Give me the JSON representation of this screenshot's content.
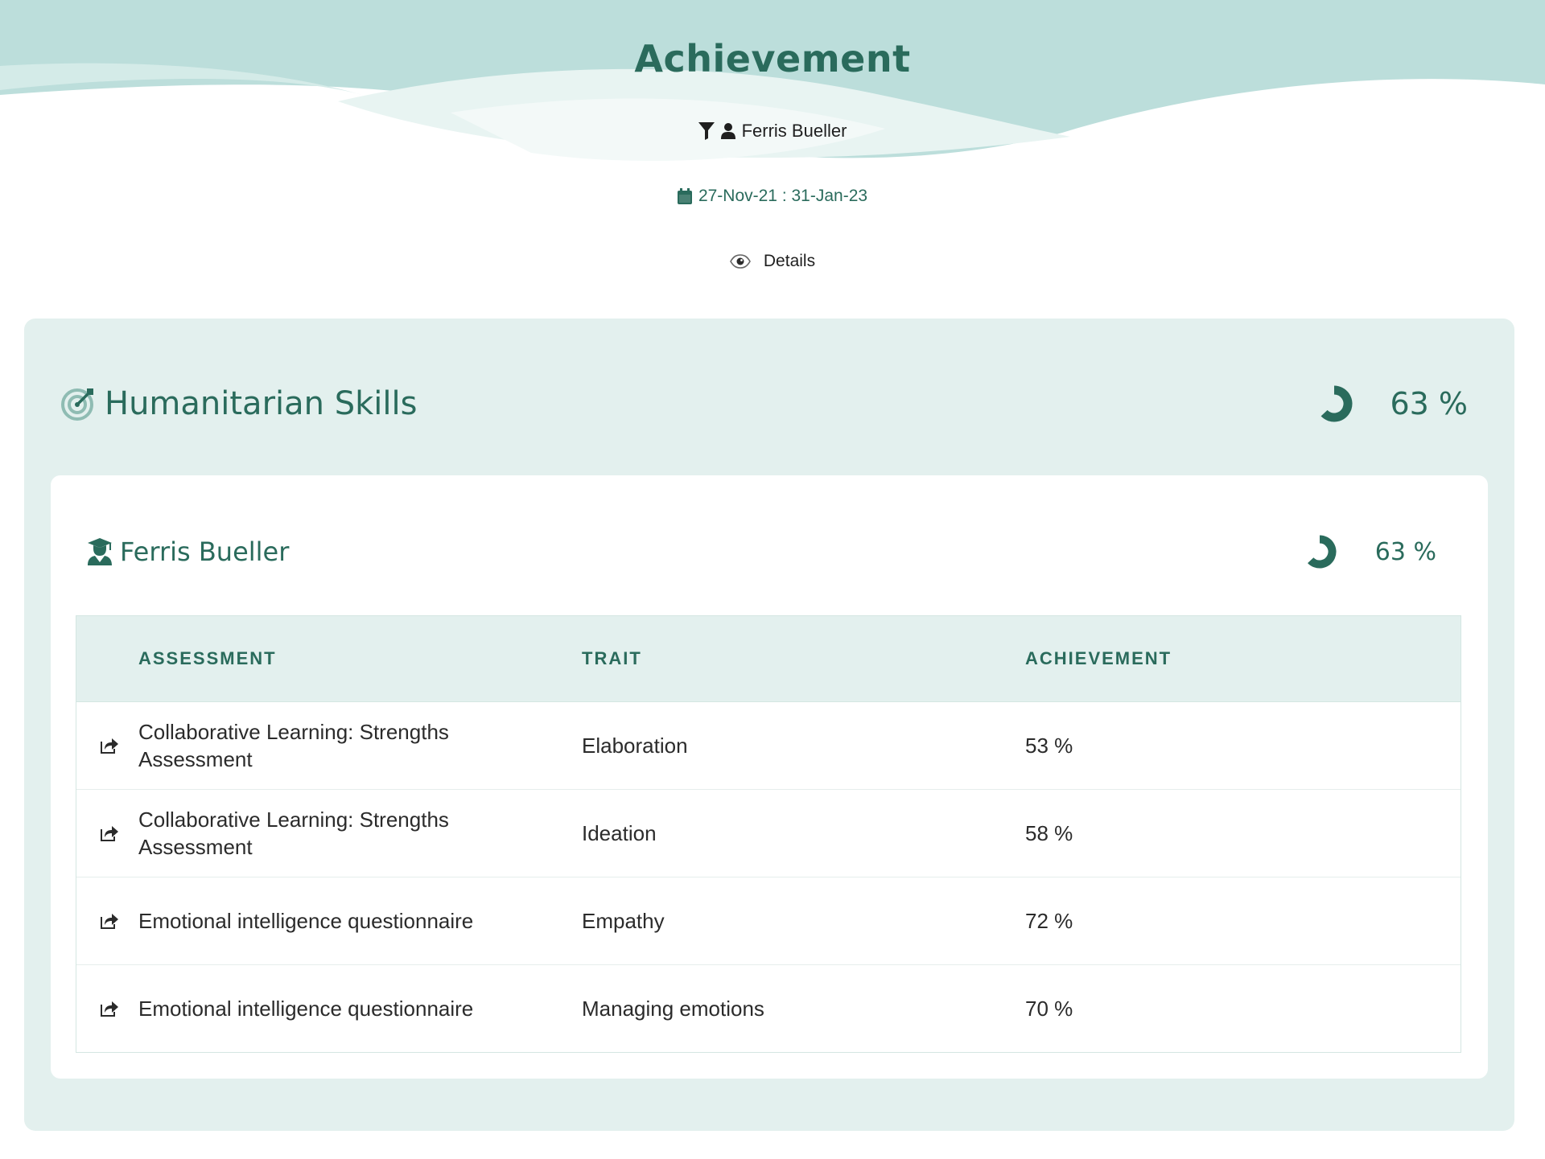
{
  "header": {
    "title": "Achievement",
    "filter_user": "Ferris Bueller",
    "date_range": "27-Nov-21 : 31-Jan-23",
    "details_label": "Details"
  },
  "section": {
    "title": "Humanitarian Skills",
    "progress": 0.63,
    "percent": "63 %"
  },
  "card": {
    "name": "Ferris Bueller",
    "progress": 0.63,
    "percent": "63 %"
  },
  "table": {
    "headers": [
      "ASSESSMENT",
      "TRAIT",
      "ACHIEVEMENT"
    ],
    "rows": [
      {
        "assessment": "Collaborative Learning: Strengths Assessment",
        "trait": "Elaboration",
        "achievement": "53 %"
      },
      {
        "assessment": "Collaborative Learning: Strengths Assessment",
        "trait": "Ideation",
        "achievement": "58 %"
      },
      {
        "assessment": "Emotional intelligence questionnaire",
        "trait": "Empathy",
        "achievement": "72 %"
      },
      {
        "assessment": "Emotional intelligence questionnaire",
        "trait": "Managing emotions",
        "achievement": "70 %"
      }
    ]
  },
  "colors": {
    "accent": "#2a6b5c",
    "wave": "#bcdedb",
    "panel": "#e3f0ee",
    "card": "#ffffff"
  },
  "icons": {
    "filter": "filter-icon",
    "user": "user-icon",
    "calendar": "calendar-icon",
    "eye": "eye-icon",
    "target": "target-arrow-icon",
    "student": "graduate-icon",
    "share": "share-icon"
  }
}
